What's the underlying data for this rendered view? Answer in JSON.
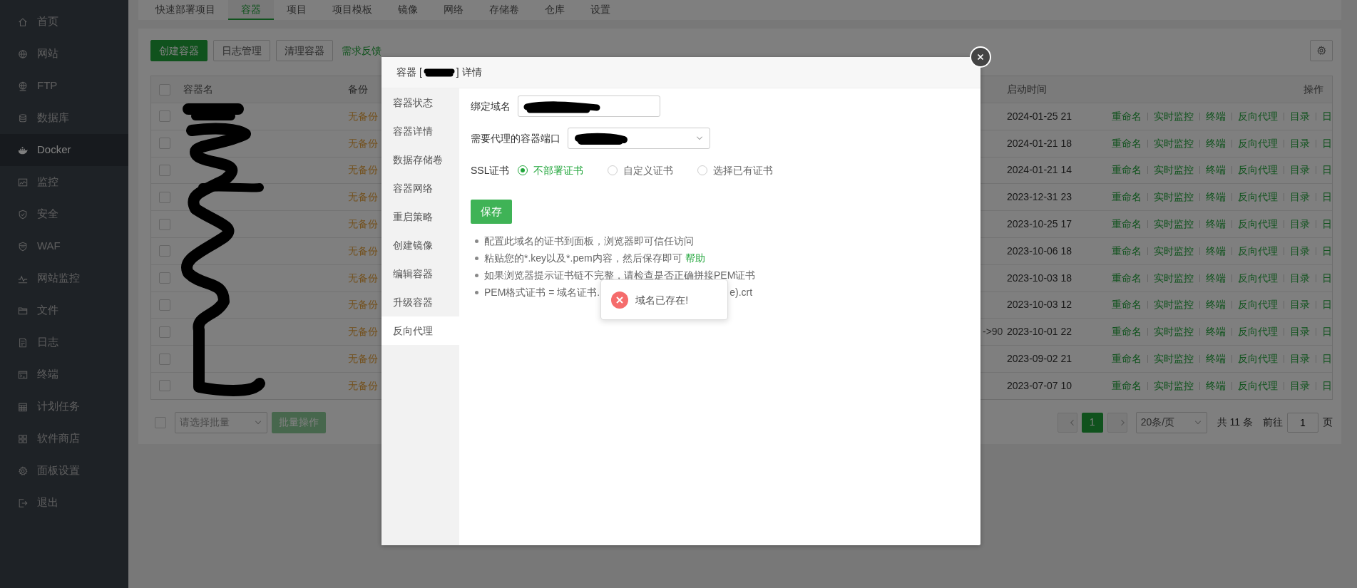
{
  "sidebar": {
    "items": [
      {
        "label": "首页",
        "selected": false
      },
      {
        "label": "网站",
        "selected": false
      },
      {
        "label": "FTP",
        "selected": false
      },
      {
        "label": "数据库",
        "selected": false
      },
      {
        "label": "Docker",
        "selected": true
      },
      {
        "label": "监控",
        "selected": false
      },
      {
        "label": "安全",
        "selected": false
      },
      {
        "label": "WAF",
        "selected": false
      },
      {
        "label": "网站监控",
        "selected": false
      },
      {
        "label": "文件",
        "selected": false
      },
      {
        "label": "日志",
        "selected": false
      },
      {
        "label": "终端",
        "selected": false
      },
      {
        "label": "计划任务",
        "selected": false
      },
      {
        "label": "软件商店",
        "selected": false
      },
      {
        "label": "面板设置",
        "selected": false
      },
      {
        "label": "退出",
        "selected": false
      }
    ]
  },
  "tabs": [
    {
      "label": "快速部署项目",
      "selected": false
    },
    {
      "label": "容器",
      "selected": true
    },
    {
      "label": "项目",
      "selected": false
    },
    {
      "label": "项目模板",
      "selected": false
    },
    {
      "label": "镜像",
      "selected": false
    },
    {
      "label": "网络",
      "selected": false
    },
    {
      "label": "存储卷",
      "selected": false
    },
    {
      "label": "仓库",
      "selected": false
    },
    {
      "label": "设置",
      "selected": false
    }
  ],
  "toolbar": {
    "buttons": [
      {
        "label": "创建容器",
        "kind": "primary"
      },
      {
        "label": "日志管理",
        "kind": "default"
      },
      {
        "label": "清理容器",
        "kind": "default"
      },
      {
        "label": "需求反馈",
        "kind": "link"
      }
    ]
  },
  "table": {
    "columns": [
      "容器名",
      "备份",
      "启动时间",
      "操作"
    ],
    "select_all_checked": false,
    "rows": [
      {
        "checked": false,
        "backup": "无备份",
        "started": "2024-01-25 21",
        "actions": [
          "重命名",
          "实时监控",
          "终端",
          "反向代理",
          "目录",
          "日"
        ]
      },
      {
        "checked": false,
        "backup": "无备份",
        "started": "2024-01-21 18",
        "actions": [
          "重命名",
          "实时监控",
          "终端",
          "反向代理",
          "目录",
          "日"
        ]
      },
      {
        "checked": false,
        "backup": "无备份",
        "started": "2024-01-21 14",
        "actions": [
          "重命名",
          "实时监控",
          "终端",
          "反向代理",
          "目录",
          "日"
        ]
      },
      {
        "checked": false,
        "backup": "无备份",
        "started": "2023-12-31 23",
        "actions": [
          "重命名",
          "实时监控",
          "终端",
          "反向代理",
          "目录",
          "日"
        ]
      },
      {
        "checked": false,
        "backup": "无备份",
        "started": "2023-10-25 17",
        "actions": [
          "重命名",
          "实时监控",
          "终端",
          "反向代理",
          "目录",
          "日"
        ]
      },
      {
        "checked": false,
        "backup": "无备份",
        "started": "2023-10-06 18",
        "actions": [
          "重命名",
          "实时监控",
          "终端",
          "反向代理",
          "目录",
          "日"
        ]
      },
      {
        "checked": false,
        "backup": "无备份",
        "started": "2023-10-03 18",
        "actions": [
          "重命名",
          "实时监控",
          "终端",
          "反向代理",
          "目录",
          "日"
        ]
      },
      {
        "checked": false,
        "backup": "无备份",
        "started": "2023-10-03 12",
        "actions": [
          "重命名",
          "实时监控",
          "终端",
          "反向代理",
          "目录",
          "日"
        ]
      },
      {
        "checked": false,
        "backup": "无备份",
        "port": "->90",
        "started": "2023-10-01 22",
        "actions": [
          "重命名",
          "实时监控",
          "终端",
          "反向代理",
          "目录",
          "日"
        ]
      },
      {
        "checked": false,
        "backup": "无备份",
        "started": "2023-09-02 21",
        "actions": [
          "重命名",
          "实时监控",
          "终端",
          "反向代理",
          "目录",
          "日"
        ]
      },
      {
        "checked": false,
        "backup": "无备份",
        "started": "2023-07-07 10",
        "actions": [
          "重命名",
          "实时监控",
          "终端",
          "反向代理",
          "目录",
          "日"
        ]
      }
    ]
  },
  "batch": {
    "checked": false,
    "select_placeholder": "请选择批量",
    "button": "批量操作"
  },
  "pagination": {
    "pages": [
      {
        "label": "1",
        "selected": true
      }
    ],
    "page_size": "20条/页",
    "total": "共 11 条",
    "goto_label": "前往",
    "goto_value": "1",
    "goto_suffix": "页"
  },
  "modal": {
    "title_prefix": "容器 [",
    "title_suffix": "] 详情",
    "nav": [
      {
        "label": "容器状态",
        "selected": false
      },
      {
        "label": "容器详情",
        "selected": false
      },
      {
        "label": "数据存储卷",
        "selected": false
      },
      {
        "label": "容器网络",
        "selected": false
      },
      {
        "label": "重启策略",
        "selected": false
      },
      {
        "label": "创建镜像",
        "selected": false
      },
      {
        "label": "编辑容器",
        "selected": false
      },
      {
        "label": "升级容器",
        "selected": false
      },
      {
        "label": "反向代理",
        "selected": true
      }
    ],
    "form": {
      "domain_label": "绑定域名",
      "port_label": "需要代理的容器端口",
      "ssl_label": "SSL证书",
      "ssl_options": [
        {
          "label": "不部署证书",
          "selected": true
        },
        {
          "label": "自定义证书",
          "selected": false
        },
        {
          "label": "选择已有证书",
          "selected": false
        }
      ],
      "save": "保存"
    },
    "tips": [
      {
        "text": "配置此域名的证书到面板，浏览器即可信任访问"
      },
      {
        "text": "粘贴您的*.key以及*.pem内容，然后保存即可 ",
        "link": "帮助"
      },
      {
        "text": "如果浏览器提示证书链不完整，请检查是否正确拼接PEM证书"
      },
      {
        "text": "PEM格式证书 = 域名证书.",
        "text_after": "e).crt"
      }
    ]
  },
  "toast": {
    "kind": "error",
    "message": "域名已存在!"
  }
}
